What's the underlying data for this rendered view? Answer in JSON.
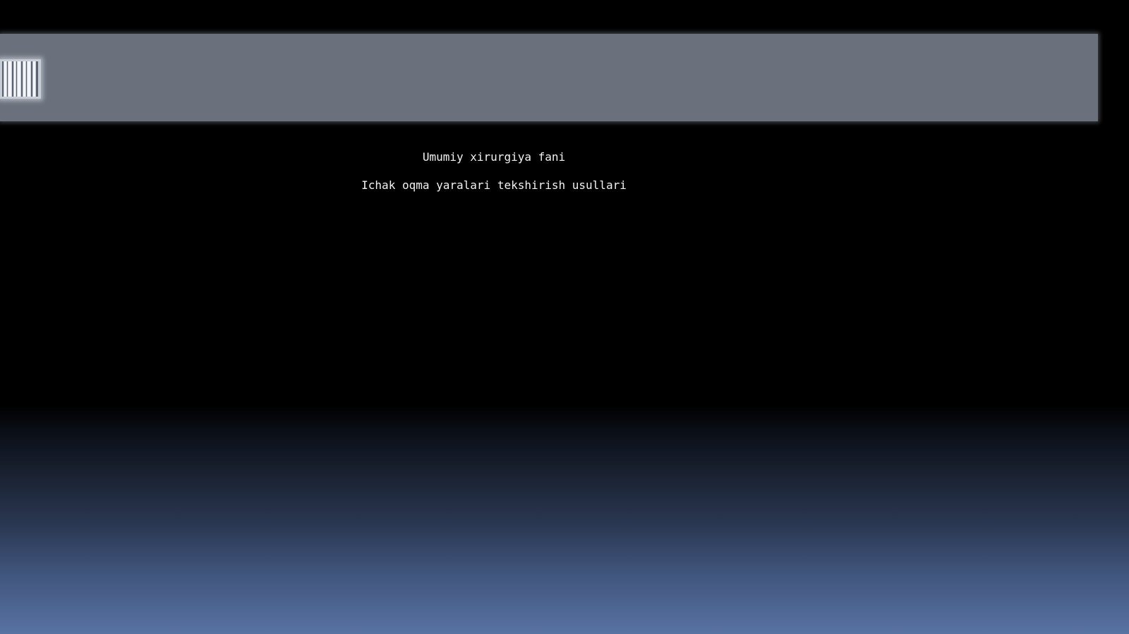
{
  "slide": {
    "subject": "Umumiy xirurgiya fani",
    "topic": "Ichak oqma yaralari tekshirish usullari"
  },
  "colors": {
    "background": "#000000",
    "band": "#6b717c",
    "gradient_bottom": "#5872a2",
    "text": "#f2f2f2"
  },
  "icons": {
    "decoration": "barcode-icon"
  }
}
